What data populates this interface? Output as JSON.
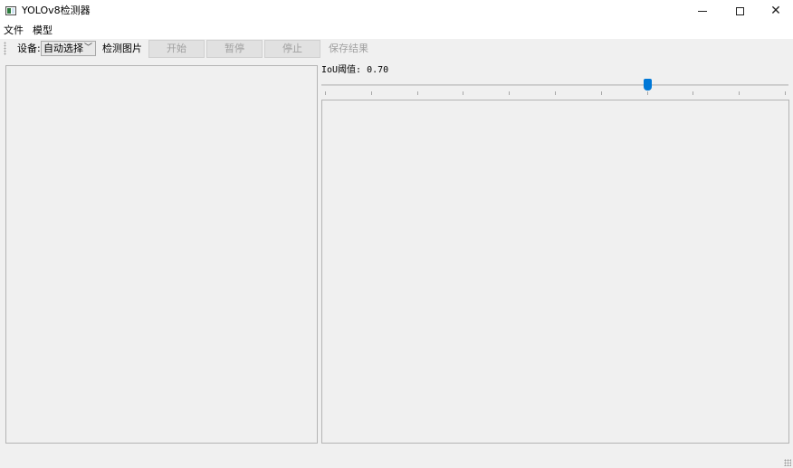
{
  "window": {
    "title": "YOLOv8检测器",
    "controls": {
      "minimize": "minimize",
      "maximize": "maximize",
      "close": "✕"
    }
  },
  "menu": {
    "file": "文件",
    "model": "模型"
  },
  "toolbar": {
    "device_label": "设备:",
    "device_value": "自动选择",
    "detect_image": "检测图片",
    "start": "开始",
    "pause": "暂停",
    "stop": "停止",
    "save_results": "保存结果"
  },
  "iou": {
    "label": "IoU阈值: 0.70",
    "value": 0.7,
    "min": 0,
    "max": 1,
    "tick_count": 11
  }
}
